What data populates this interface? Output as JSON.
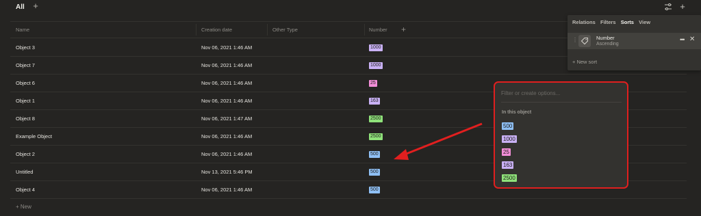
{
  "topbar": {
    "view_title": "All",
    "add_view_icon": "plus-icon",
    "settings_icon": "sliders-icon",
    "add_icon": "plus-icon"
  },
  "table": {
    "headers": [
      "Name",
      "Creation date",
      "Other Type",
      "Number"
    ],
    "add_column_icon": "plus-icon",
    "rows": [
      {
        "name": "Object 3",
        "date": "Nov 06, 2021 1:46 AM",
        "number": "1000",
        "color": "#c9b1f5"
      },
      {
        "name": "Object 7",
        "date": "Nov 06, 2021 1:46 AM",
        "number": "1000",
        "color": "#c9b1f5"
      },
      {
        "name": "Object 6",
        "date": "Nov 06, 2021 1:46 AM",
        "number": "25",
        "color": "#f28ed8"
      },
      {
        "name": "Object 1",
        "date": "Nov 06, 2021 1:46 AM",
        "number": "163",
        "color": "#c9b1f5"
      },
      {
        "name": "Object 8",
        "date": "Nov 06, 2021 1:47 AM",
        "number": "2500",
        "color": "#8fe27a"
      },
      {
        "name": "Example Object",
        "date": "Nov 06, 2021 1:46 AM",
        "number": "2500",
        "color": "#8fe27a"
      },
      {
        "name": "Object 2",
        "date": "Nov 06, 2021 1:46 AM",
        "number": "500",
        "color": "#8fc0f5"
      },
      {
        "name": "Untitled",
        "date": "Nov 13, 2021 5:46 PM",
        "number": "500",
        "color": "#8fc0f5"
      },
      {
        "name": "Object 4",
        "date": "Nov 06, 2021 1:46 AM",
        "number": "500",
        "color": "#8fc0f5"
      }
    ],
    "new_row": "+ New"
  },
  "sort_panel": {
    "tabs": [
      "Relations",
      "Filters",
      "Sorts",
      "View"
    ],
    "active_tab": "Sorts",
    "sort": {
      "name": "Number",
      "direction": "Ascending",
      "icon": "tag-icon"
    },
    "new_sort": "+ New sort"
  },
  "dropdown": {
    "placeholder": "Filter or create options...",
    "section_label": "In this object",
    "options": [
      {
        "label": "500",
        "color": "#8fc0f5"
      },
      {
        "label": "1000",
        "color": "#c9b1f5"
      },
      {
        "label": "25",
        "color": "#f28ed8"
      },
      {
        "label": "163",
        "color": "#c9b1f5"
      },
      {
        "label": "2500",
        "color": "#8fe27a"
      }
    ]
  },
  "colors": {
    "annotation_red": "#e11f1f"
  }
}
